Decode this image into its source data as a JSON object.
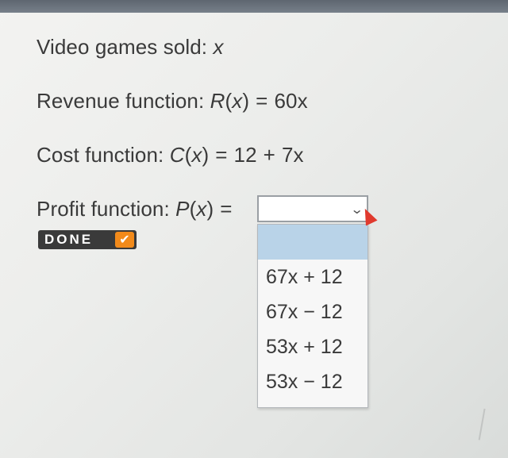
{
  "problem": {
    "line1": {
      "label": "Video games sold: ",
      "var": "x"
    },
    "line2": {
      "label": "Revenue function: ",
      "fname": "R",
      "arg": "x",
      "eq": "=",
      "rhs": "60x"
    },
    "line3": {
      "label": "Cost function: ",
      "fname": "C",
      "arg": "x",
      "eq": "=",
      "rhs_a": "12",
      "plus": "+",
      "rhs_b": "7x"
    },
    "line4": {
      "label": "Profit function: ",
      "fname": "P",
      "arg": "x",
      "eq": "="
    }
  },
  "select": {
    "value": "",
    "chevron": "chevron-down-icon"
  },
  "done_button": {
    "label": "DONE",
    "check": "✔"
  },
  "dropdown": {
    "options": [
      "67x + 12",
      "67x − 12",
      "53x + 12",
      "53x − 12"
    ]
  },
  "colors": {
    "highlight": "#b9d3e8",
    "done_bg": "#3a3a3a",
    "check_bg": "#f28a1a",
    "cursor": "#e03a2e"
  }
}
